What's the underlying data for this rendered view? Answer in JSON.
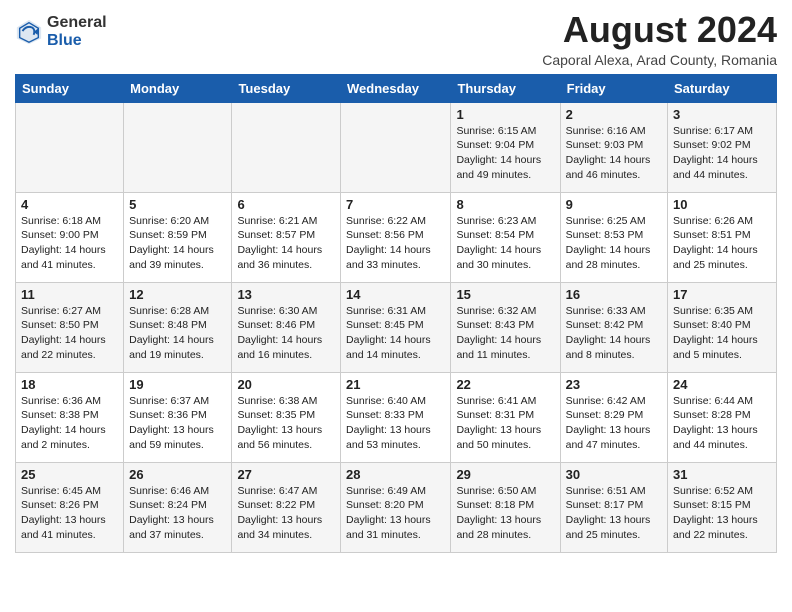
{
  "header": {
    "logo_general": "General",
    "logo_blue": "Blue",
    "main_title": "August 2024",
    "subtitle": "Caporal Alexa, Arad County, Romania"
  },
  "weekdays": [
    "Sunday",
    "Monday",
    "Tuesday",
    "Wednesday",
    "Thursday",
    "Friday",
    "Saturday"
  ],
  "weeks": [
    [
      {
        "day": "",
        "info": ""
      },
      {
        "day": "",
        "info": ""
      },
      {
        "day": "",
        "info": ""
      },
      {
        "day": "",
        "info": ""
      },
      {
        "day": "1",
        "info": "Sunrise: 6:15 AM\nSunset: 9:04 PM\nDaylight: 14 hours\nand 49 minutes."
      },
      {
        "day": "2",
        "info": "Sunrise: 6:16 AM\nSunset: 9:03 PM\nDaylight: 14 hours\nand 46 minutes."
      },
      {
        "day": "3",
        "info": "Sunrise: 6:17 AM\nSunset: 9:02 PM\nDaylight: 14 hours\nand 44 minutes."
      }
    ],
    [
      {
        "day": "4",
        "info": "Sunrise: 6:18 AM\nSunset: 9:00 PM\nDaylight: 14 hours\nand 41 minutes."
      },
      {
        "day": "5",
        "info": "Sunrise: 6:20 AM\nSunset: 8:59 PM\nDaylight: 14 hours\nand 39 minutes."
      },
      {
        "day": "6",
        "info": "Sunrise: 6:21 AM\nSunset: 8:57 PM\nDaylight: 14 hours\nand 36 minutes."
      },
      {
        "day": "7",
        "info": "Sunrise: 6:22 AM\nSunset: 8:56 PM\nDaylight: 14 hours\nand 33 minutes."
      },
      {
        "day": "8",
        "info": "Sunrise: 6:23 AM\nSunset: 8:54 PM\nDaylight: 14 hours\nand 30 minutes."
      },
      {
        "day": "9",
        "info": "Sunrise: 6:25 AM\nSunset: 8:53 PM\nDaylight: 14 hours\nand 28 minutes."
      },
      {
        "day": "10",
        "info": "Sunrise: 6:26 AM\nSunset: 8:51 PM\nDaylight: 14 hours\nand 25 minutes."
      }
    ],
    [
      {
        "day": "11",
        "info": "Sunrise: 6:27 AM\nSunset: 8:50 PM\nDaylight: 14 hours\nand 22 minutes."
      },
      {
        "day": "12",
        "info": "Sunrise: 6:28 AM\nSunset: 8:48 PM\nDaylight: 14 hours\nand 19 minutes."
      },
      {
        "day": "13",
        "info": "Sunrise: 6:30 AM\nSunset: 8:46 PM\nDaylight: 14 hours\nand 16 minutes."
      },
      {
        "day": "14",
        "info": "Sunrise: 6:31 AM\nSunset: 8:45 PM\nDaylight: 14 hours\nand 14 minutes."
      },
      {
        "day": "15",
        "info": "Sunrise: 6:32 AM\nSunset: 8:43 PM\nDaylight: 14 hours\nand 11 minutes."
      },
      {
        "day": "16",
        "info": "Sunrise: 6:33 AM\nSunset: 8:42 PM\nDaylight: 14 hours\nand 8 minutes."
      },
      {
        "day": "17",
        "info": "Sunrise: 6:35 AM\nSunset: 8:40 PM\nDaylight: 14 hours\nand 5 minutes."
      }
    ],
    [
      {
        "day": "18",
        "info": "Sunrise: 6:36 AM\nSunset: 8:38 PM\nDaylight: 14 hours\nand 2 minutes."
      },
      {
        "day": "19",
        "info": "Sunrise: 6:37 AM\nSunset: 8:36 PM\nDaylight: 13 hours\nand 59 minutes."
      },
      {
        "day": "20",
        "info": "Sunrise: 6:38 AM\nSunset: 8:35 PM\nDaylight: 13 hours\nand 56 minutes."
      },
      {
        "day": "21",
        "info": "Sunrise: 6:40 AM\nSunset: 8:33 PM\nDaylight: 13 hours\nand 53 minutes."
      },
      {
        "day": "22",
        "info": "Sunrise: 6:41 AM\nSunset: 8:31 PM\nDaylight: 13 hours\nand 50 minutes."
      },
      {
        "day": "23",
        "info": "Sunrise: 6:42 AM\nSunset: 8:29 PM\nDaylight: 13 hours\nand 47 minutes."
      },
      {
        "day": "24",
        "info": "Sunrise: 6:44 AM\nSunset: 8:28 PM\nDaylight: 13 hours\nand 44 minutes."
      }
    ],
    [
      {
        "day": "25",
        "info": "Sunrise: 6:45 AM\nSunset: 8:26 PM\nDaylight: 13 hours\nand 41 minutes."
      },
      {
        "day": "26",
        "info": "Sunrise: 6:46 AM\nSunset: 8:24 PM\nDaylight: 13 hours\nand 37 minutes."
      },
      {
        "day": "27",
        "info": "Sunrise: 6:47 AM\nSunset: 8:22 PM\nDaylight: 13 hours\nand 34 minutes."
      },
      {
        "day": "28",
        "info": "Sunrise: 6:49 AM\nSunset: 8:20 PM\nDaylight: 13 hours\nand 31 minutes."
      },
      {
        "day": "29",
        "info": "Sunrise: 6:50 AM\nSunset: 8:18 PM\nDaylight: 13 hours\nand 28 minutes."
      },
      {
        "day": "30",
        "info": "Sunrise: 6:51 AM\nSunset: 8:17 PM\nDaylight: 13 hours\nand 25 minutes."
      },
      {
        "day": "31",
        "info": "Sunrise: 6:52 AM\nSunset: 8:15 PM\nDaylight: 13 hours\nand 22 minutes."
      }
    ]
  ]
}
